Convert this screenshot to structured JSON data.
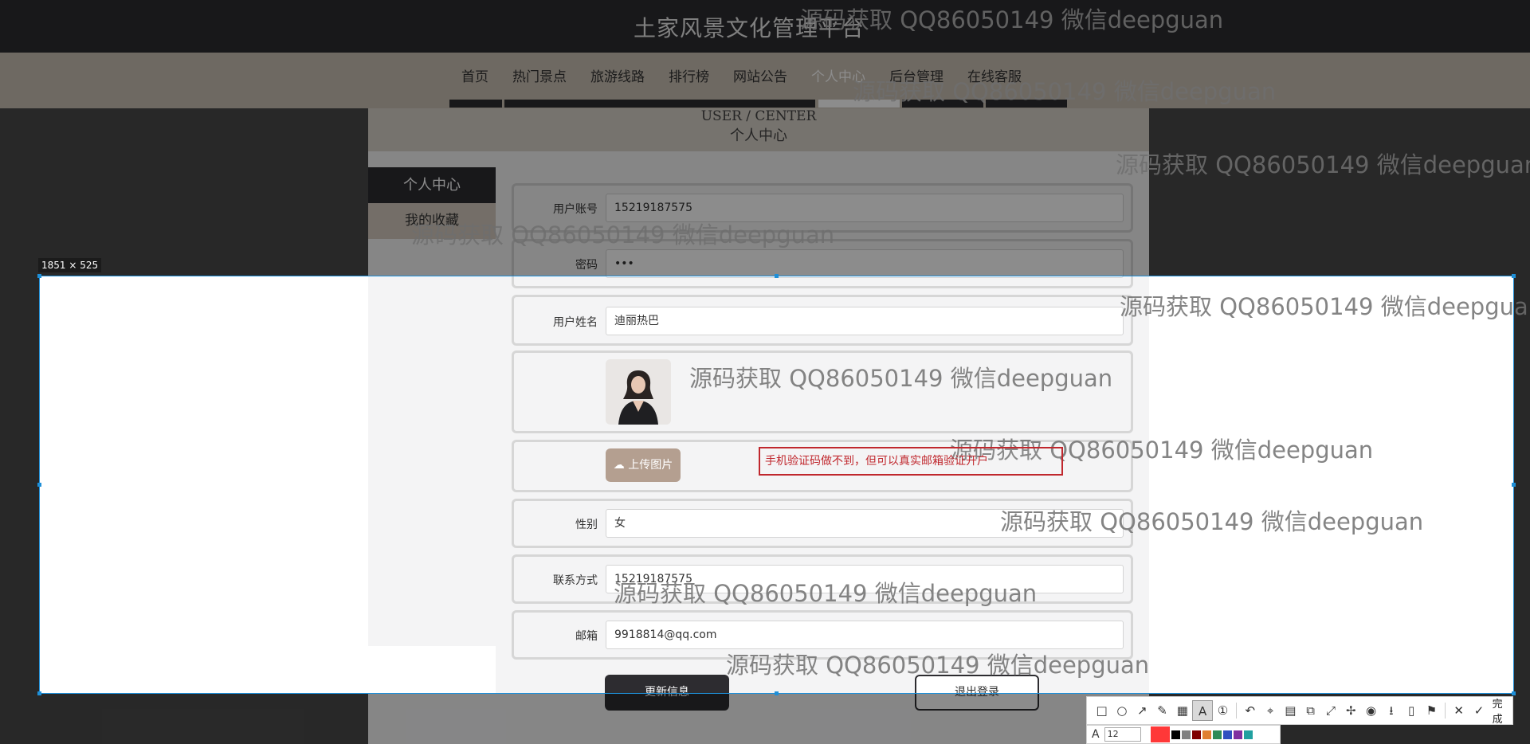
{
  "site": {
    "title": "土家风景文化管理平台",
    "nav": [
      "首页",
      "热门景点",
      "旅游线路",
      "排行榜",
      "网站公告",
      "个人中心",
      "后台管理",
      "在线客服"
    ],
    "active_nav": "个人中心"
  },
  "banner": {
    "en": "USER / CENTER",
    "cn": "个人中心"
  },
  "sidebar": {
    "header": "个人中心",
    "items": [
      "我的收藏"
    ]
  },
  "form": {
    "account_label": "用户账号",
    "account_value": "15219187575",
    "password_label": "密码",
    "password_value": "•••",
    "name_label": "用户姓名",
    "name_value": "迪丽热巴",
    "upload_label": "上传图片",
    "gender_label": "性别",
    "gender_value": "女",
    "phone_label": "联系方式",
    "phone_value": "15219187575",
    "email_label": "邮箱",
    "email_value": "9918814@qq.com",
    "update_button": "更新信息",
    "logout_button": "退出登录"
  },
  "annotation": {
    "text": "手机验证码做不到，但可以真实邮箱验证开户"
  },
  "screenshot_tool": {
    "size_label": "1851 × 525",
    "done_label": "完成",
    "font_size": "12",
    "icons": [
      "rectangle-icon",
      "ellipse-icon",
      "arrow-icon",
      "pen-icon",
      "mosaic-icon",
      "text-icon",
      "number-icon",
      "undo-icon",
      "pin-icon",
      "ocr-icon",
      "translate-icon",
      "long-screenshot-icon",
      "thumbtack-icon",
      "record-icon",
      "save-icon",
      "phone-icon",
      "bookmark-icon",
      "close-icon"
    ],
    "colors": [
      "#000000",
      "#808080",
      "#800000",
      "#e08030",
      "#2e8b57",
      "#3050c0",
      "#8030a0",
      "#20a0a0"
    ]
  },
  "watermark": {
    "text": "源码获取 QQ86050149 微信deepguan"
  }
}
